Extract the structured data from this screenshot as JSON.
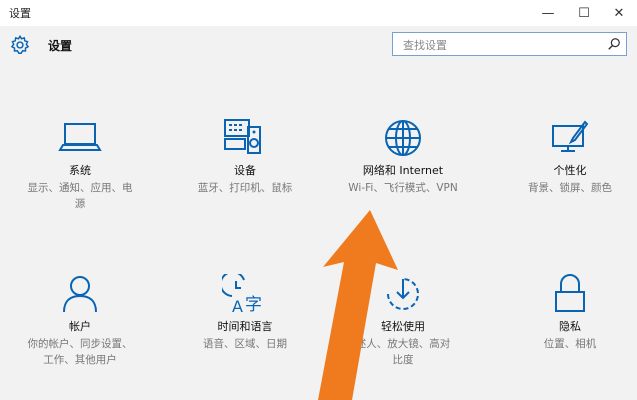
{
  "window": {
    "title": "设置",
    "minimize_glyph": "—",
    "maximize_glyph": "☐",
    "close_glyph": "✕"
  },
  "header": {
    "title": "设置",
    "icon": "gear-icon"
  },
  "search": {
    "placeholder": "查找设置",
    "value": "",
    "icon": "search-icon"
  },
  "colors": {
    "accent": "#0a64b4",
    "arrow": "#f07a1e",
    "background": "#f2f2f2"
  },
  "tiles": [
    {
      "name": "系统",
      "desc_line1": "显示、通知、应用、电",
      "desc_line2": "源",
      "icon": "laptop-icon"
    },
    {
      "name": "设备",
      "desc_line1": "蓝牙、打印机、鼠标",
      "icon": "devices-icon"
    },
    {
      "name": "网络和 Internet",
      "desc_line1": "Wi-Fi、飞行模式、VPN",
      "icon": "globe-icon"
    },
    {
      "name": "个性化",
      "desc_line1": "背景、锁屏、颜色",
      "icon": "personalization-icon"
    },
    {
      "name": "帐户",
      "desc_line1": "你的帐户、同步设置、",
      "desc_line2": "工作、其他用户",
      "icon": "person-icon"
    },
    {
      "name": "时间和语言",
      "desc_line1": "语音、区域、日期",
      "icon": "time-language-icon"
    },
    {
      "name": "轻松使用",
      "desc_line1": "述人、放大镜、高对",
      "desc_line2": "比度",
      "icon": "ease-of-access-icon"
    },
    {
      "name": "隐私",
      "desc_line1": "位置、相机",
      "icon": "lock-icon"
    }
  ]
}
